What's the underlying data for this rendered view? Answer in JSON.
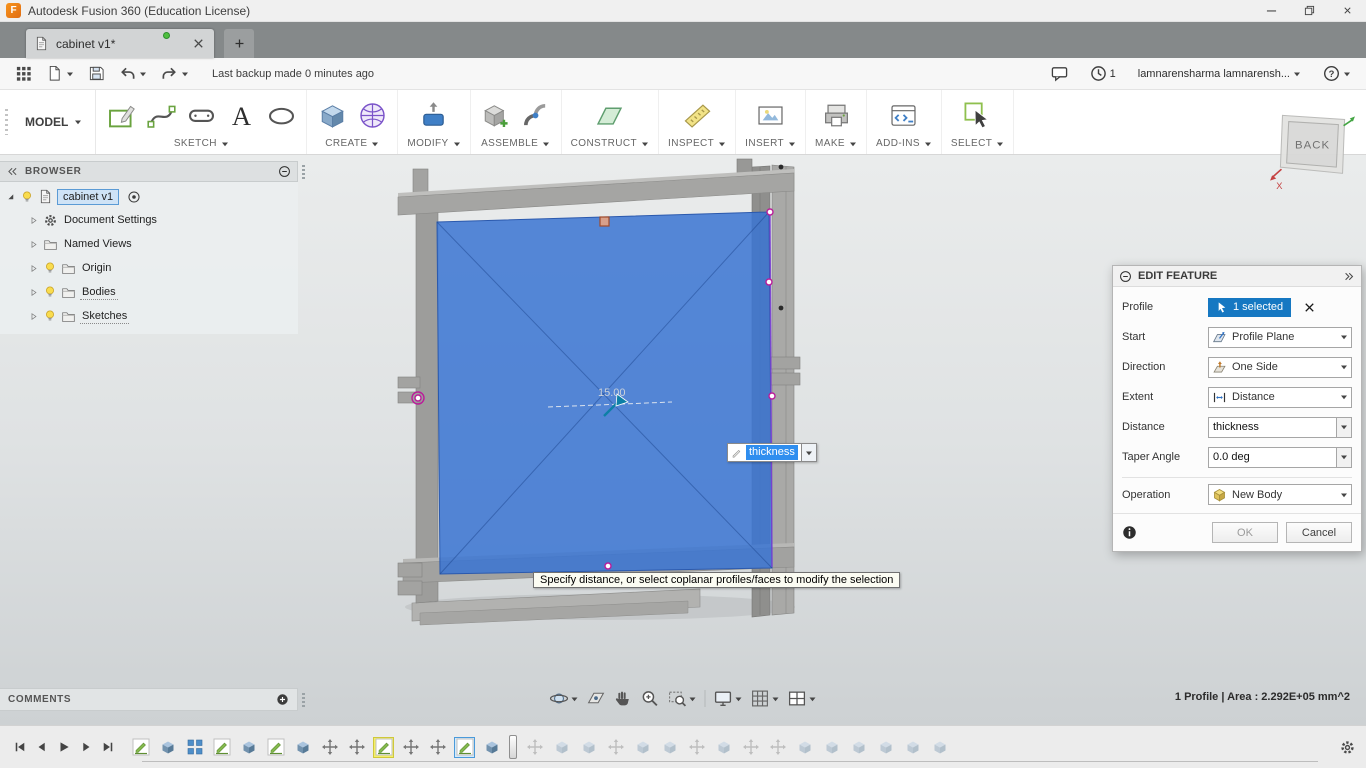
{
  "icons": {
    "logo_letter": "F",
    "question_glyph": "?",
    "text_tool_glyph": "A"
  },
  "window": {
    "title": "Autodesk Fusion 360 (Education License)"
  },
  "tabs": {
    "active_label": "cabinet v1*"
  },
  "appbar": {
    "backup_status": "Last backup made 0 minutes ago",
    "notification_count": "1",
    "user_name": "lamnarensharma lamnarensh..."
  },
  "ribbon": {
    "workspace": "MODEL",
    "groups": [
      {
        "label": "SKETCH",
        "icons": [
          "rb-sketch",
          "rb-spline",
          "rb-slot",
          "rb-text",
          "rb-ellipse"
        ]
      },
      {
        "label": "CREATE",
        "icons": [
          "rb-box",
          "rb-form"
        ]
      },
      {
        "label": "MODIFY",
        "icons": [
          "rb-presspull"
        ]
      },
      {
        "label": "ASSEMBLE",
        "icons": [
          "rb-component",
          "rb-joint"
        ]
      },
      {
        "label": "CONSTRUCT",
        "icons": [
          "rb-plane"
        ]
      },
      {
        "label": "INSPECT",
        "icons": [
          "rb-measure"
        ]
      },
      {
        "label": "INSERT",
        "icons": [
          "rb-insert"
        ]
      },
      {
        "label": "MAKE",
        "icons": [
          "rb-make"
        ]
      },
      {
        "label": "ADD-INS",
        "icons": [
          "rb-addins"
        ]
      },
      {
        "label": "SELECT",
        "icons": [
          "rb-select"
        ]
      }
    ]
  },
  "viewcube": {
    "face": "BACK",
    "axis_x_label": "X"
  },
  "browser": {
    "title": "BROWSER",
    "root_label": "cabinet v1",
    "items": [
      {
        "label": "Document Settings",
        "icon": "gear",
        "bulb": false,
        "underline": false
      },
      {
        "label": "Named Views",
        "icon": "folder",
        "bulb": false,
        "underline": false
      },
      {
        "label": "Origin",
        "icon": "folder",
        "bulb": true,
        "underline": false
      },
      {
        "label": "Bodies",
        "icon": "folder",
        "bulb": true,
        "underline": true
      },
      {
        "label": "Sketches",
        "icon": "folder",
        "bulb": true,
        "underline": true
      }
    ]
  },
  "canvas": {
    "dimension_label": "15.00",
    "inline_input_value": "thickness",
    "status_tooltip": "Specify distance, or select coplanar profiles/faces to modify the selection"
  },
  "dialog": {
    "title": "EDIT FEATURE",
    "rows": [
      {
        "label": "Profile",
        "type": "chip",
        "value": "1 selected",
        "separated": false
      },
      {
        "label": "Start",
        "type": "select",
        "icon": "ic-plane",
        "value": "Profile Plane",
        "separated": false
      },
      {
        "label": "Direction",
        "type": "select",
        "icon": "ic-oneside",
        "value": "One Side",
        "separated": false
      },
      {
        "label": "Extent",
        "type": "select",
        "icon": "ic-distance",
        "value": "Distance",
        "separated": false
      },
      {
        "label": "Distance",
        "type": "input",
        "value": "thickness",
        "separated": false
      },
      {
        "label": "Taper Angle",
        "type": "input",
        "value": "0.0 deg",
        "separated": false
      },
      {
        "label": "Operation",
        "type": "select",
        "icon": "ic-newbody",
        "value": "New Body",
        "separated": true
      }
    ],
    "ok_label": "OK",
    "cancel_label": "Cancel"
  },
  "comments": {
    "title": "COMMENTS"
  },
  "statusbar": {
    "selection_info": "1 Profile | Area : 2.292E+05 mm^2"
  },
  "navbar": {
    "items": [
      {
        "icon": "nav-orbit",
        "caret": true,
        "sep_after": false
      },
      {
        "icon": "nav-lookat",
        "caret": false,
        "sep_after": false
      },
      {
        "icon": "nav-pan",
        "caret": false,
        "sep_after": false
      },
      {
        "icon": "nav-zoom",
        "caret": false,
        "sep_after": false
      },
      {
        "icon": "nav-fit",
        "caret": true,
        "sep_after": true
      },
      {
        "icon": "nav-display",
        "caret": true,
        "sep_after": false
      },
      {
        "icon": "nav-grid",
        "caret": true,
        "sep_after": false
      },
      {
        "icon": "nav-viewports",
        "caret": true,
        "sep_after": false
      }
    ]
  },
  "timeline": {
    "playback": [
      "skip-start",
      "step-back",
      "play",
      "step-forward",
      "skip-end"
    ],
    "marker_index": 14,
    "features": [
      {
        "type": "sketch",
        "state": "normal"
      },
      {
        "type": "extrude",
        "state": "normal"
      },
      {
        "type": "pattern",
        "state": "normal"
      },
      {
        "type": "sketch",
        "state": "normal"
      },
      {
        "type": "extrude",
        "state": "normal"
      },
      {
        "type": "sketch",
        "state": "normal"
      },
      {
        "type": "extrude",
        "state": "normal"
      },
      {
        "type": "move",
        "state": "normal"
      },
      {
        "type": "move",
        "state": "normal"
      },
      {
        "type": "sketch",
        "state": "highlight"
      },
      {
        "type": "move",
        "state": "normal"
      },
      {
        "type": "move",
        "state": "normal"
      },
      {
        "type": "sketch",
        "state": "selected"
      },
      {
        "type": "extrude",
        "state": "normal"
      },
      {
        "type": "move",
        "state": "future"
      },
      {
        "type": "extrude",
        "state": "future"
      },
      {
        "type": "extrude",
        "state": "future"
      },
      {
        "type": "move",
        "state": "future"
      },
      {
        "type": "extrude",
        "state": "future"
      },
      {
        "type": "extrude",
        "state": "future"
      },
      {
        "type": "move",
        "state": "future"
      },
      {
        "type": "extrude",
        "state": "future"
      },
      {
        "type": "move",
        "state": "future"
      },
      {
        "type": "move",
        "state": "future"
      },
      {
        "type": "extrude",
        "state": "future"
      },
      {
        "type": "extrude",
        "state": "future"
      },
      {
        "type": "extrude",
        "state": "future"
      },
      {
        "type": "extrude",
        "state": "future"
      },
      {
        "type": "extrude",
        "state": "future"
      },
      {
        "type": "extrude",
        "state": "future"
      }
    ]
  }
}
